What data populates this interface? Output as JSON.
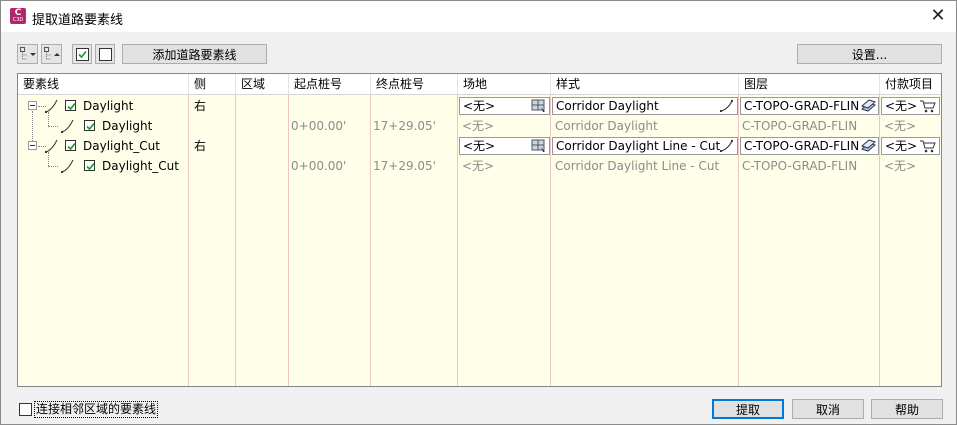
{
  "window": {
    "title": "提取道路要素线",
    "icon_label_main": "C",
    "icon_label_sub": "C3D",
    "close_glyph": "✕"
  },
  "toolbar": {
    "add_button": "添加道路要素线",
    "settings_button": "设置..."
  },
  "grid": {
    "columns": [
      "要素线",
      "侧",
      "区域",
      "起点桩号",
      "终点桩号",
      "场地",
      "样式",
      "图层",
      "付款项目"
    ],
    "rows": [
      {
        "name": "Daylight",
        "side": "右",
        "region": "",
        "start": "",
        "end": "",
        "site": "<无>",
        "style": "Corridor Daylight",
        "layer": "C-TOPO-GRAD-FLIN",
        "pay": "<无>",
        "editable": true
      },
      {
        "name": "Daylight",
        "side": "",
        "region": "",
        "start": "0+00.00'",
        "end": "17+29.05'",
        "site": "<无>",
        "style": "Corridor Daylight",
        "layer": "C-TOPO-GRAD-FLIN",
        "pay": "<无>",
        "editable": false
      },
      {
        "name": "Daylight_Cut",
        "side": "右",
        "region": "",
        "start": "",
        "end": "",
        "site": "<无>",
        "style": "Corridor Daylight Line - Cut",
        "layer": "C-TOPO-GRAD-FLIN",
        "pay": "<无>",
        "editable": true
      },
      {
        "name": "Daylight_Cut",
        "side": "",
        "region": "",
        "start": "0+00.00'",
        "end": "17+29.05'",
        "site": "<无>",
        "style": "Corridor Daylight Line - Cut",
        "layer": "C-TOPO-GRAD-FLIN",
        "pay": "<无>",
        "editable": false
      }
    ]
  },
  "footer": {
    "join_checkbox_label": "连接相邻区域的要素线",
    "extract_button": "提取",
    "cancel_button": "取消",
    "help_button": "帮助"
  }
}
